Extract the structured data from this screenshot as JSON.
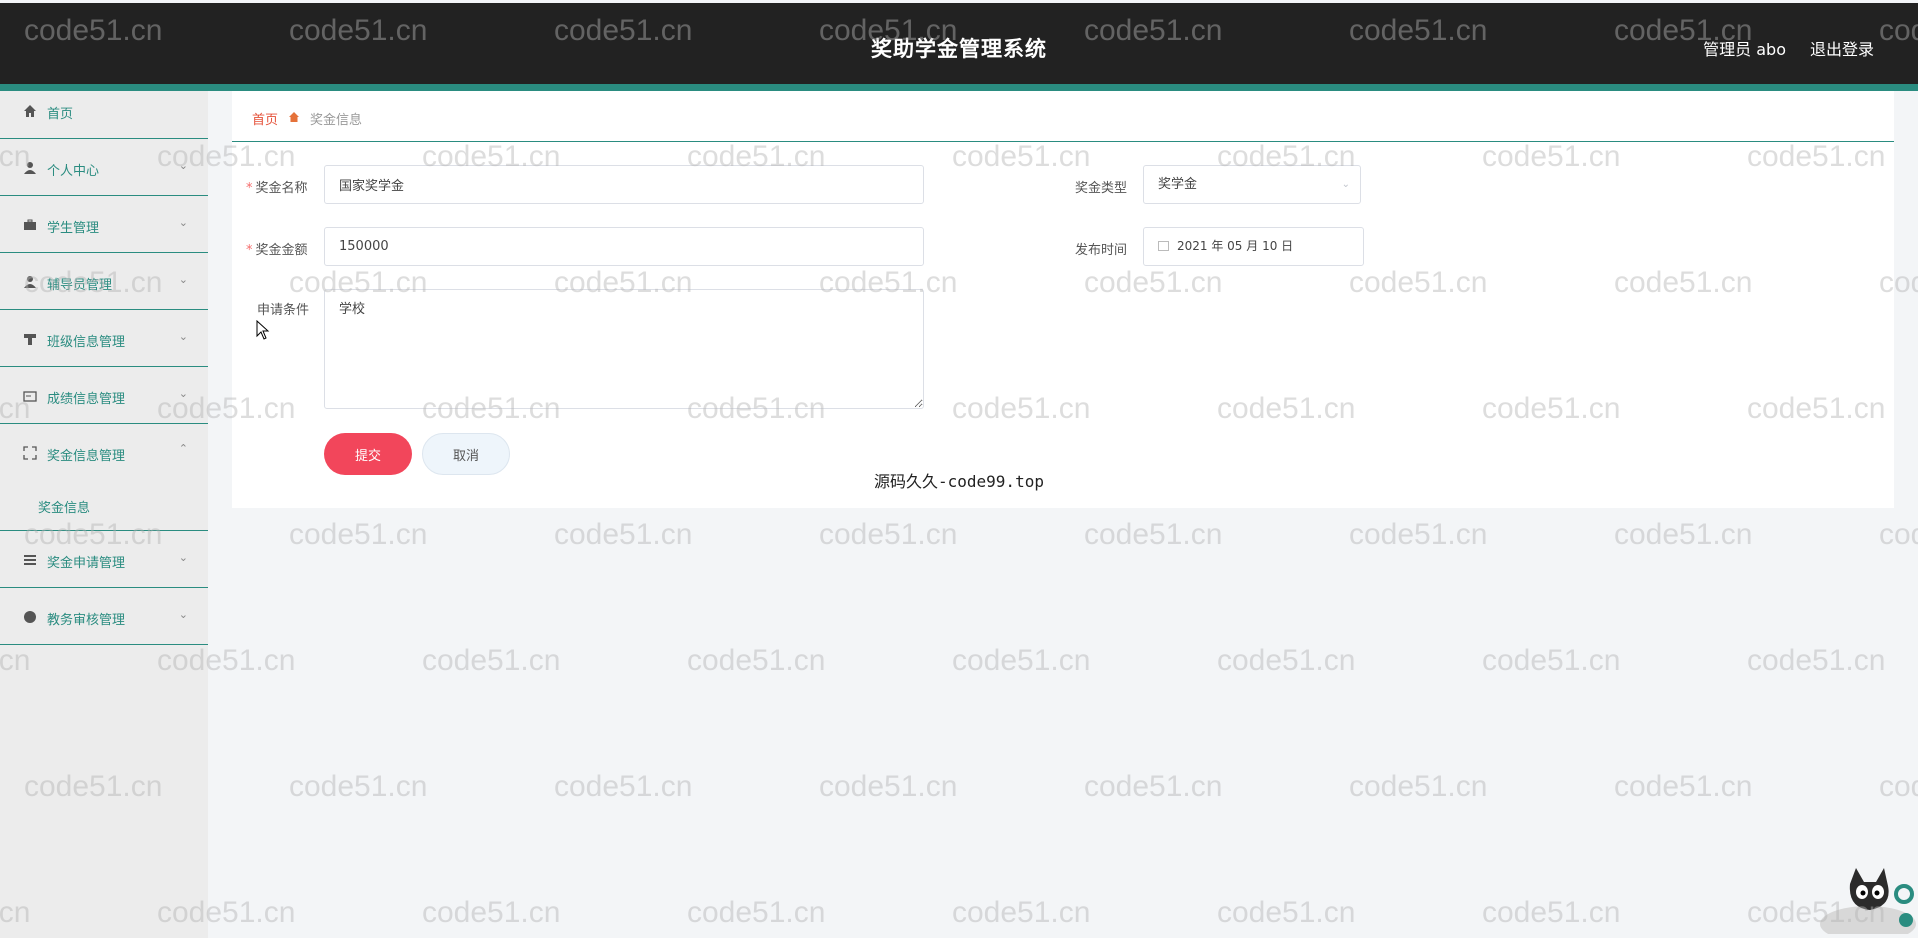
{
  "header": {
    "title": "奖助学金管理系统",
    "user_label": "管理员 abo",
    "logout_label": "退出登录"
  },
  "sidebar": {
    "items": [
      {
        "label": "首页",
        "icon": "home-icon"
      },
      {
        "label": "个人中心",
        "icon": "user-icon"
      },
      {
        "label": "学生管理",
        "icon": "briefcase-icon"
      },
      {
        "label": "辅导员管理",
        "icon": "user-icon"
      },
      {
        "label": "班级信息管理",
        "icon": "podium-icon"
      },
      {
        "label": "成绩信息管理",
        "icon": "card-icon"
      },
      {
        "label": "奖金信息管理",
        "icon": "expand-icon"
      },
      {
        "label": "奖金申请管理",
        "icon": "list-icon"
      },
      {
        "label": "教务审核管理",
        "icon": "globe-icon"
      }
    ],
    "sub_item": "奖金信息"
  },
  "breadcrumb": {
    "home": "首页",
    "current": "奖金信息"
  },
  "form": {
    "name_label": "奖金名称",
    "name_value": "国家奖学金",
    "type_label": "奖金类型",
    "type_value": "奖学金",
    "amount_label": "奖金金额",
    "amount_value": "150000",
    "date_label": "发布时间",
    "date_value": "2021 年 05 月 10 日",
    "condition_label": "申请条件",
    "condition_value": "学校",
    "submit_label": "提交",
    "cancel_label": "取消"
  },
  "caption": "源码久久-code99.top",
  "watermark": "code51.cn",
  "colors": {
    "accent": "#2a8c80",
    "header_bg": "#222222",
    "submit_bg": "#f2465b"
  }
}
